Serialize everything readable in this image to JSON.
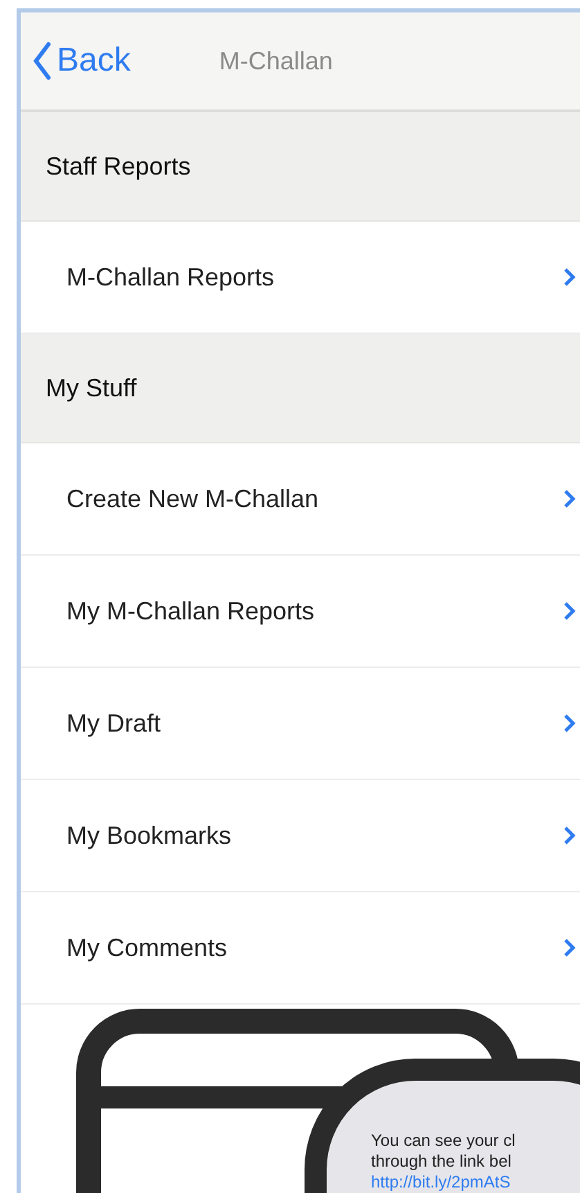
{
  "nav": {
    "back": "Back",
    "title": "M-Challan"
  },
  "sections": [
    {
      "header": "Staff Reports",
      "rows": [
        {
          "label": "M-Challan Reports"
        }
      ]
    },
    {
      "header": "My Stuff",
      "rows": [
        {
          "label": "Create New M-Challan"
        },
        {
          "label": "My M-Challan Reports"
        },
        {
          "label": "My Draft"
        },
        {
          "label": "My Bookmarks"
        },
        {
          "label": "My Comments"
        }
      ]
    }
  ],
  "message": {
    "lines": [
      "You can see your cl",
      "through the link bel"
    ],
    "link": "http://bit.ly/2pmAtS"
  }
}
